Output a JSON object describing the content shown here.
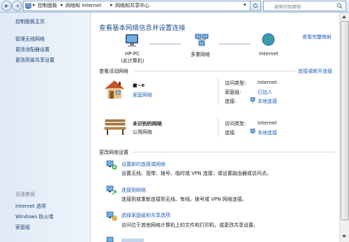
{
  "address_bar": {
    "crumbs": [
      "控制面板",
      "网络和 Internet",
      "网络和共享中心"
    ],
    "search_placeholder": "搜索控制面板"
  },
  "sidebar": {
    "home": "控制面板主页",
    "links": [
      "管理无线网络",
      "更改适配器设置",
      "更改高级共享设置"
    ],
    "see_also_heading": "另请参阅",
    "see_also": [
      "Internet 选项",
      "Windows 防火墙",
      "家庭组"
    ]
  },
  "main": {
    "title": "查看基本网络信息并设置连接",
    "full_map_link": "查看完整映射",
    "map": {
      "pc_name": "HP-PC",
      "pc_sub": "(此计算机)",
      "multi_network": "多重网络",
      "internet": "Internet"
    },
    "active_networks_heading": "查看活动网络",
    "connect_disconnect_link": "连接或断开连接",
    "networks": [
      {
        "name": "■~e",
        "type": "家庭网络",
        "access_type_label": "访问类型:",
        "access_type": "Internet",
        "homegroup_label": "家庭组:",
        "homegroup": "已加入",
        "connection_label": "连接:",
        "connection": "本地连接"
      },
      {
        "name": "未识别的网络",
        "type": "公用网络",
        "access_type_label": "访问类型:",
        "access_type": "Internet",
        "connection_label": "连接:",
        "connection": "本地连接"
      }
    ],
    "change_settings_heading": "更改网络设置",
    "tasks": [
      {
        "title": "设置新的连接或网络",
        "desc": "设置无线、宽带、拨号、临时或 VPN 连接；或设置路由器或访问点。"
      },
      {
        "title": "连接到网络",
        "desc": "连接到或重新连接到无线、有线、拨号或 VPN 网络连接。"
      },
      {
        "title": "选择家庭组和共享选项",
        "desc": "访问位于其他网络计算机上的文件和打印机，或更改共享设置。"
      }
    ]
  }
}
